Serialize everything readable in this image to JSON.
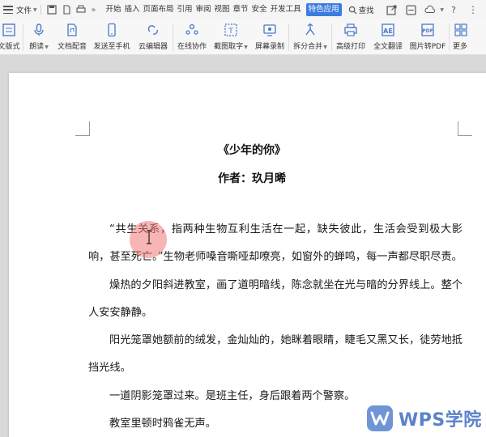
{
  "menubar": {
    "file_label": "文件",
    "more_symbol": "»",
    "tabs": [
      "开始",
      "插入",
      "页面布局",
      "引用",
      "审阅",
      "视图",
      "章节",
      "安全",
      "开发工具"
    ],
    "active_tab": "特色应用",
    "search_label": "查找",
    "help_label": "?",
    "accent_color": "#3d7be0"
  },
  "toolbar": {
    "items": [
      {
        "label": "文版式",
        "icon": "layout-icon"
      },
      {
        "label": "朗读",
        "icon": "microphone-icon",
        "dropdown": true
      },
      {
        "label": "文档配音",
        "icon": "document-audio-icon"
      },
      {
        "label": "发送至手机",
        "icon": "phone-icon"
      },
      {
        "label": "云编辑器",
        "icon": "cloud-editor-icon"
      },
      {
        "label": "在线协作",
        "icon": "collaboration-icon"
      },
      {
        "label": "截图取字",
        "icon": "screenshot-text-icon",
        "dropdown": true
      },
      {
        "label": "屏幕录制",
        "icon": "screen-record-icon"
      },
      {
        "label": "拆分合并",
        "icon": "split-merge-icon",
        "dropdown": true
      },
      {
        "label": "高级打印",
        "icon": "printer-icon"
      },
      {
        "label": "全文翻译",
        "icon": "translate-icon"
      },
      {
        "label": "图片转PDF",
        "icon": "image-to-pdf-icon"
      },
      {
        "label": "更多",
        "icon": "more-icon"
      }
    ]
  },
  "document": {
    "title": "《少年的你》",
    "author": "作者：玖月晞",
    "paragraphs": [
      "“共生关系，指两种生物互利生活在一起，缺失彼此，生活会受到极大影响，甚至死亡。”生物老师嗓音嘶哑却嘹亮，如窗外的蝉鸣，每一声都尽职尽责。",
      "燥热的夕阳斜进教室，画了道明暗线，陈念就坐在光与暗的分界线上。整个人安安静静。",
      "阳光笼罩她额前的绒发，金灿灿的，她眯着眼睛，睫毛又黑又长，徒劳地抵挡光线。",
      "一道阴影笼罩过来。是班主任，身后跟着两个警察。",
      "教室里顿时鸦雀无声。"
    ]
  },
  "watermark": {
    "text": "WPS学院"
  }
}
